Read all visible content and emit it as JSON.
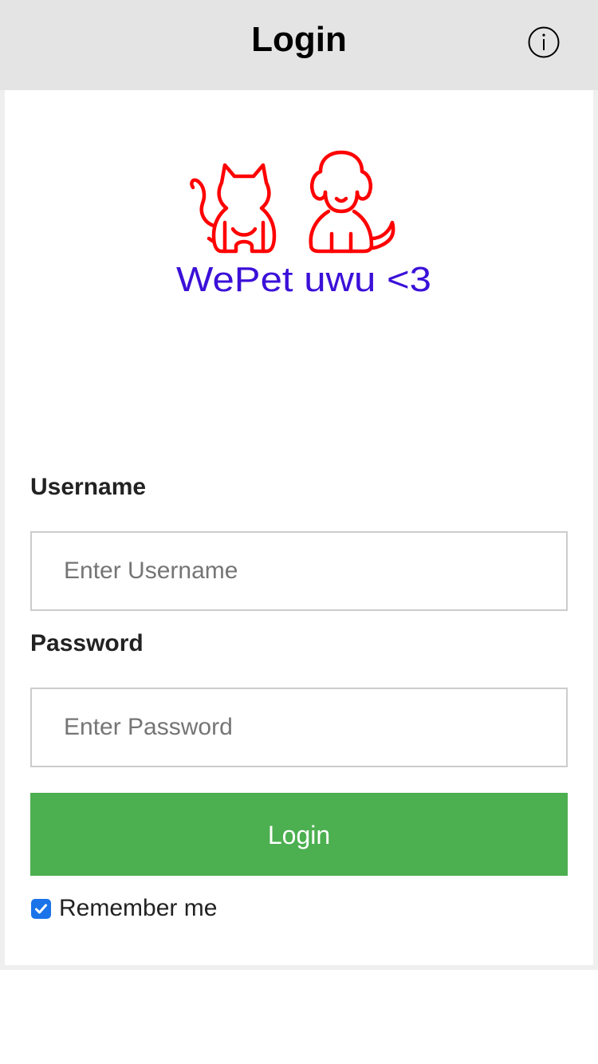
{
  "header": {
    "title": "Login",
    "info_icon": "info-icon"
  },
  "logo": {
    "text": "WePet uwu <3",
    "icon": "cat-and-dog-logo",
    "colors": {
      "pets": "#ff0000",
      "text": "#3b10d8"
    }
  },
  "form": {
    "username": {
      "label": "Username",
      "placeholder": "Enter Username",
      "value": ""
    },
    "password": {
      "label": "Password",
      "placeholder": "Enter Password",
      "value": ""
    },
    "login_button": "Login",
    "remember": {
      "label": "Remember me",
      "checked": true
    }
  },
  "colors": {
    "header_bg": "#e4e4e4",
    "button_bg": "#4caf50",
    "checkbox": "#1a73e8"
  }
}
